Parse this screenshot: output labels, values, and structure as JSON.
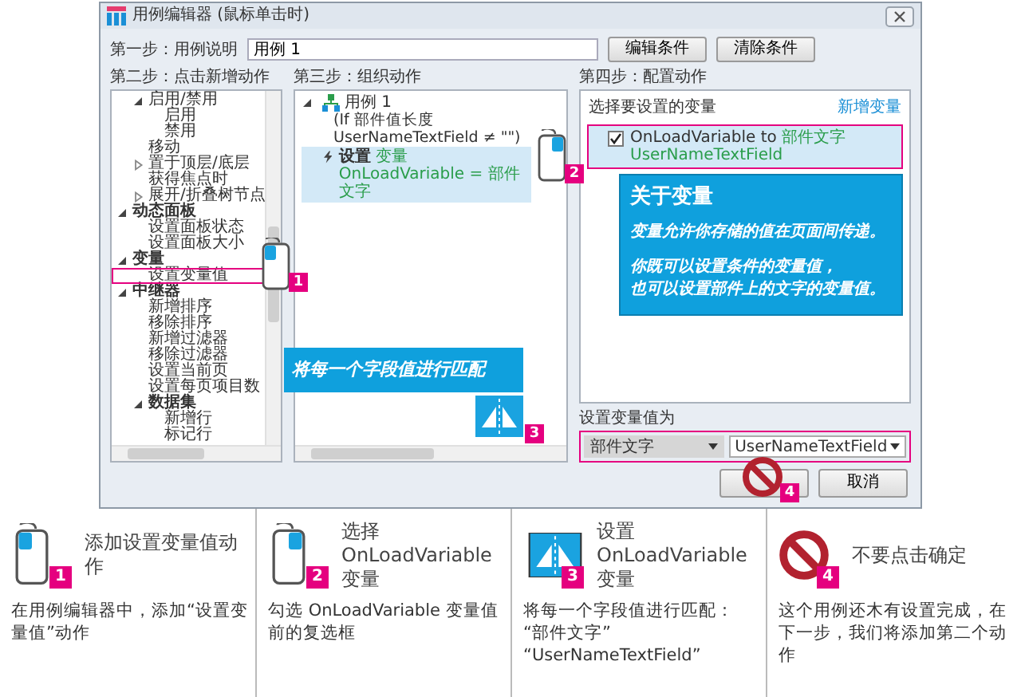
{
  "dialog": {
    "title": "用例编辑器 (鼠标单击时)",
    "step1": {
      "label": "第一步：用例说明",
      "value": "用例 1",
      "buttons": [
        "编辑条件",
        "清除条件"
      ]
    },
    "step2": {
      "heading": "第二步：点击新增动作",
      "tree_continued": [
        {
          "label": "启用/禁用",
          "expanded": true,
          "selected": false,
          "children": [
            {
              "label": "启用",
              "selected": false
            },
            {
              "label": "禁用",
              "selected": false
            }
          ]
        },
        {
          "label": "移动",
          "selected": false
        },
        {
          "label": "置于顶层/底层",
          "expanded": false,
          "selected": false
        },
        {
          "label": "获得焦点时",
          "selected": false
        },
        {
          "label": "展开/折叠树节点",
          "expanded": false,
          "selected": false
        }
      ],
      "tree": [
        {
          "label": "动态面板",
          "expanded": true,
          "selected": false,
          "children": [
            {
              "label": "设置面板状态",
              "selected": false
            },
            {
              "label": "设置面板大小",
              "selected": false
            }
          ]
        },
        {
          "label": "变量",
          "expanded": true,
          "selected": false,
          "children": [
            {
              "label": "设置变量值",
              "selected": true
            }
          ]
        },
        {
          "label": "中继器",
          "expanded": true,
          "selected": false,
          "children": [
            {
              "label": "新增排序",
              "selected": false
            },
            {
              "label": "移除排序",
              "selected": false
            },
            {
              "label": "新增过滤器",
              "selected": false
            },
            {
              "label": "移除过滤器",
              "selected": false
            },
            {
              "label": "设置当前页",
              "selected": false
            },
            {
              "label": "设置每页项目数",
              "selected": false
            },
            {
              "label": "数据集",
              "expanded": true,
              "selected": false,
              "children": [
                {
                  "label": "新增行",
                  "selected": false
                },
                {
                  "label": "标记行",
                  "selected": false
                }
              ]
            }
          ]
        }
      ]
    },
    "step3": {
      "heading": "第三步：组织动作",
      "case": {
        "label": "用例 1",
        "expanded": true,
        "condition": "(If 部件值长度 UserNameTextField ≠ \"\")",
        "actions": [
          {
            "verb": "设置",
            "detail": "变量 OnLoadVariable = 部件文字",
            "selected": true
          }
        ]
      }
    },
    "step4": {
      "heading": "第四步：配置动作",
      "select_label": "选择要设置的变量",
      "new_variable_link": "新增变量",
      "variables": [
        {
          "name": "OnLoadVariable",
          "connector": "to",
          "target": "部件文字 UserNameTextField",
          "checked": true,
          "selected": true
        }
      ],
      "value_label": "设置变量值为",
      "value_type": "部件文字",
      "value_field": "UserNameTextField"
    },
    "cancel_button": "取消"
  },
  "annotations": {
    "variable_tip": {
      "title": "关于变量",
      "paragraphs": [
        [
          "变量允许你存储的值在页面间传递。"
        ],
        [
          "你既可以设置条件的变量值，",
          "也可以设置部件上的文字的变量值。"
        ]
      ]
    },
    "match_tip": "将每一个字段值进行匹配",
    "badges": [
      "1",
      "2",
      "3",
      "4"
    ]
  },
  "steps": [
    {
      "kind": "mouse",
      "badge": "1",
      "title": "添加设置变量值动作",
      "desc_lines": [
        "在用例编辑器中，添加“设置变量值”动作"
      ]
    },
    {
      "kind": "mouse",
      "badge": "2",
      "title": "选择 OnLoadVariable 变量",
      "desc_lines": [
        "勾选 OnLoadVariable 变量值前的复选框"
      ]
    },
    {
      "kind": "match",
      "badge": "3",
      "title": "设置 OnLoadVariable 变量",
      "desc_lines": [
        "将每一个字段值进行匹配：",
        "“部件文字”",
        "“UserNameTextField”"
      ]
    },
    {
      "kind": "forbidden",
      "badge": "4",
      "title": "不要点击确定",
      "desc_lines": [
        "这个用例还木有设置完成，在下一步，我们将添加第二个动作"
      ]
    }
  ]
}
